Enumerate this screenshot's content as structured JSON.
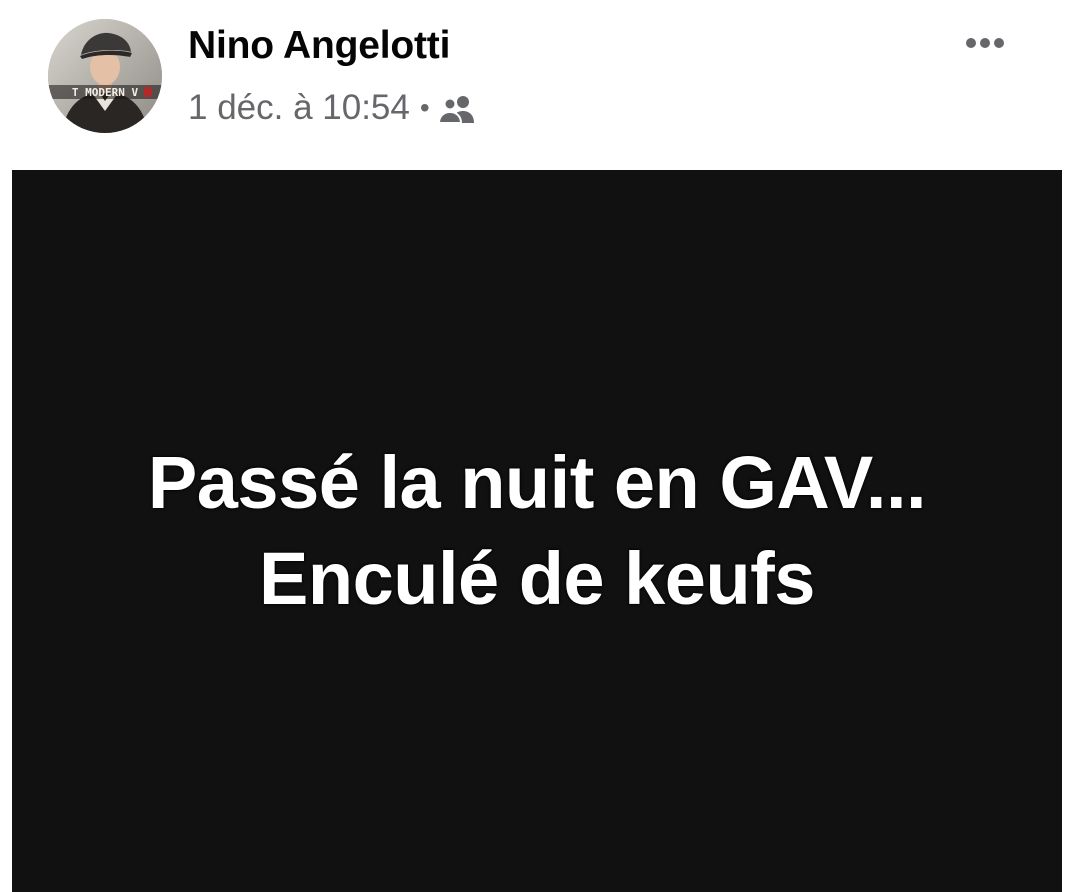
{
  "post": {
    "author": {
      "name": "Nino Angelotti",
      "avatar_icon": "profile-photo",
      "avatar_caption": "T MODERN V"
    },
    "timestamp": "1 déc. à 10:54",
    "separator": "•",
    "audience_icon": "friends-icon",
    "more_options_icon": "more-horizontal-icon",
    "body": {
      "line1": "Passé la nuit en GAV...",
      "line2": "Enculé de keufs",
      "background_color": "#111111",
      "text_color": "#ffffff"
    }
  },
  "colors": {
    "name_text": "#050505",
    "secondary_text": "#65676b"
  }
}
